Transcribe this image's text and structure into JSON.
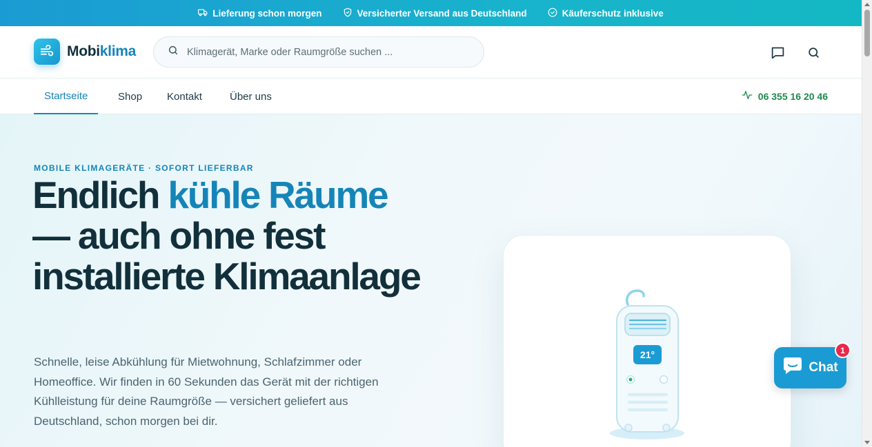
{
  "topbar": {
    "items": [
      {
        "label": "Lieferung schon morgen",
        "icon": "truck-icon"
      },
      {
        "label": "Versicherter Versand aus Deutschland",
        "icon": "shield-check-icon"
      },
      {
        "label": "Käuferschutz inklusive",
        "icon": "check-circle-icon"
      }
    ]
  },
  "header": {
    "logo_part1": "Mobi",
    "logo_part2": "klima",
    "search_placeholder": "Klimagerät, Marke oder Raumgröße suchen ..."
  },
  "nav": {
    "items": [
      "Startseite",
      "Shop",
      "Kontakt",
      "Über uns"
    ],
    "active": "Startseite",
    "phone": "06 355 16 20 46"
  },
  "hero": {
    "eyebrow": "MOBILE KLIMAGERÄTE · SOFORT LIEFERBAR",
    "headline_part1": "Endlich ",
    "headline_accent": "kühle Räume",
    "headline_part2": " — auch ohne fest installierte Klimaanlage",
    "lead": "Schnelle, leise Abkühlung für Mietwohnung, Schlafzimmer oder Homeoffice. Wir finden in 60 Sekunden das Gerät mit der richtigen Kühlleistung für deine Raumgröße — versichert geliefert aus Deutschland, schon morgen bei dir.",
    "device_temperature": "21°"
  },
  "chat": {
    "label": "Chat",
    "badge": "1"
  },
  "colors": {
    "accent": "#1585b8",
    "topbar": "#18b3cc",
    "phone": "#1e8a4c",
    "badge": "#e8294c"
  }
}
